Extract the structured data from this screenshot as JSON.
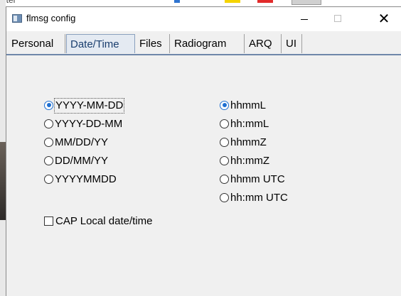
{
  "background": {
    "fragment_text": "nter"
  },
  "window": {
    "title": "flmsg config",
    "icon": "app-icon",
    "close_glyph": "✕"
  },
  "tabs": [
    {
      "label": "Personal",
      "active": false
    },
    {
      "label": "Date/Time",
      "active": true
    },
    {
      "label": "Files",
      "active": false
    },
    {
      "label": "Radiogram",
      "active": false
    },
    {
      "label": "ARQ",
      "active": false
    },
    {
      "label": "UI",
      "active": false
    }
  ],
  "date_format": {
    "options": [
      "YYYY-MM-DD",
      "YYYY-DD-MM",
      "MM/DD/YY",
      "DD/MM/YY",
      "YYYYMMDD"
    ],
    "selected": "YYYY-MM-DD"
  },
  "time_format": {
    "options": [
      "hhmmL",
      "hh:mmL",
      "hhmmZ",
      "hh:mmZ",
      "hhmm UTC",
      "hh:mm UTC"
    ],
    "selected": "hhmmL"
  },
  "cap_local": {
    "label": "CAP Local date/time",
    "checked": false
  },
  "colors": {
    "accent": "#1e6fd1",
    "active_tab_bg": "#e4eaf2",
    "panel_bg": "#f0f0f0"
  }
}
